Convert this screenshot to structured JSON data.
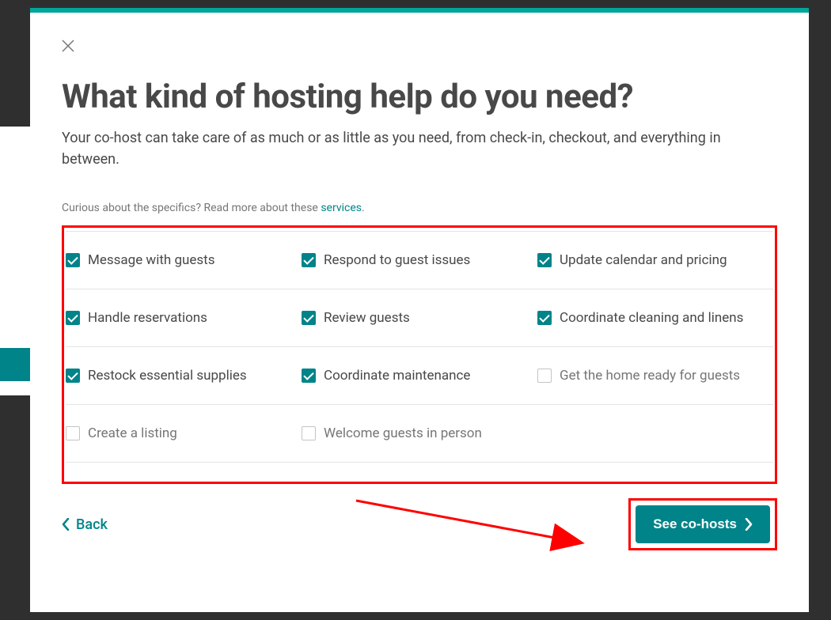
{
  "modal": {
    "title": "What kind of hosting help do you need?",
    "subtitle": "Your co-host can take care of as much or as little as you need, from check-in, checkout, and everything in between.",
    "tip_prefix": "Curious about the specifics? Read more about these ",
    "tip_link": "services",
    "tip_suffix": ".",
    "options": {
      "row1": {
        "c1": {
          "label": "Message with guests",
          "checked": true
        },
        "c2": {
          "label": "Respond to guest issues",
          "checked": true
        },
        "c3": {
          "label": "Update calendar and pricing",
          "checked": true
        }
      },
      "row2": {
        "c1": {
          "label": "Handle reservations",
          "checked": true
        },
        "c2": {
          "label": "Review guests",
          "checked": true
        },
        "c3": {
          "label": "Coordinate cleaning and linens",
          "checked": true
        }
      },
      "row3": {
        "c1": {
          "label": "Restock essential supplies",
          "checked": true
        },
        "c2": {
          "label": "Coordinate maintenance",
          "checked": true
        },
        "c3": {
          "label": "Get the home ready for guests",
          "checked": false
        }
      },
      "row4": {
        "c1": {
          "label": "Create a listing",
          "checked": false
        },
        "c2": {
          "label": "Welcome guests in person",
          "checked": false
        }
      }
    },
    "back_label": "Back",
    "primary_label": "See co-hosts"
  },
  "colors": {
    "accent": "#008489",
    "highlight": "#ff0000"
  }
}
